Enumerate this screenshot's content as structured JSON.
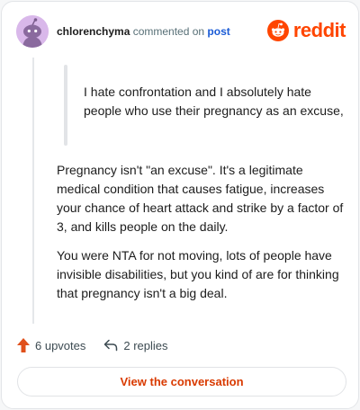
{
  "header": {
    "username": "chlorenchyma",
    "action_text": " commented on ",
    "post_link": "post",
    "brand": "reddit"
  },
  "comment": {
    "quote": "I hate confrontation and I absolutely hate people who use their pregnancy as an excuse,",
    "paragraphs": [
      "Pregnancy isn't \"an excuse\". It's a legitimate medical condition that causes fatigue, increases your chance of heart attack and strike by a factor of 3, and kills people on the daily.",
      "You were NTA for not moving, lots of people have invisible disabilities, but you kind of are for thinking that pregnancy isn't a big deal."
    ]
  },
  "stats": {
    "upvotes": "6 upvotes",
    "replies": "2 replies"
  },
  "cta": {
    "label": "View the conversation"
  },
  "colors": {
    "brand_orange": "#ff4500",
    "link_blue": "#1a5bd6",
    "cta_text": "#d93a00",
    "upvote_icon": "#e0501b",
    "avatar_bg": "#d9b8ea"
  },
  "icons": {
    "avatar": "snoo-avatar-icon",
    "brand": "reddit-logo-icon",
    "upvote": "upvote-arrow-icon",
    "reply": "reply-arrow-icon"
  }
}
